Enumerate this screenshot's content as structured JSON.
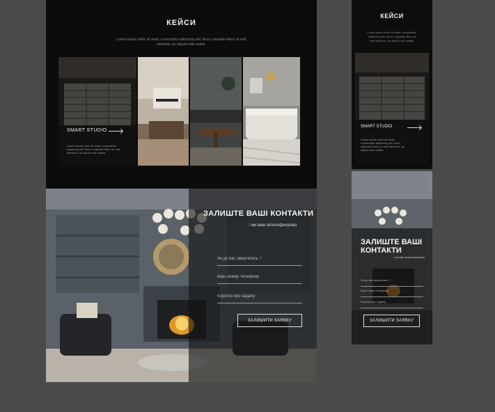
{
  "desktop": {
    "cases": {
      "title": "КЕЙСИ",
      "subtitle": "Lorem ipsum dolor sit amet, consectetur adipiscing elit. Nunc vulputate libero et velit interdum, ac aliquet odio mattis.",
      "featured_label": "SMART STUDIO",
      "featured_text": "Lorem ipsum dolor sit amet, consectetur adipiscing elit. Nunc vulputate libero et velit interdum, ac aliquet odio mattis.",
      "arrow_icon": "arrow-right-icon"
    },
    "contact": {
      "title": "ЗАЛИШТЕ ВАШІ КОНТАКТИ",
      "subtitle": "і ми вам зателефонуємо",
      "name_placeholder": "Як до вас звертатись ?",
      "phone_placeholder": "Ваш номер телефону",
      "task_placeholder": "Коротко про задачу",
      "submit_label": "ЗАЛИШИТИ ЗАЯВКУ"
    }
  },
  "mobile": {
    "cases": {
      "title": "КЕЙСИ",
      "subtitle": "Lorem ipsum dolor sit amet, consectetur adipiscing elit. Nunc vulputate libero et velit interdum, ac aliquet odio mattis.",
      "featured_label": "SMART STUDIO",
      "featured_text": "Lorem ipsum dolor sit amet, consectetur adipiscing elit. Nunc vulputate libero et velit interdum, ac aliquet odio mattis."
    },
    "contact": {
      "title": "ЗАЛИШТЕ ВАШІ КОНТАКТИ",
      "subtitle": "і ми вам зателефонуємо",
      "name_placeholder": "Як до вас звертатись ?",
      "phone_placeholder": "Ваш номер телефону",
      "task_placeholder": "Коротко про задачу",
      "submit_label": "ЗАЛИШИТИ ЗАЯВКУ"
    }
  },
  "colors": {
    "canvas": "#4a4a4a",
    "section_dark": "#0c0c0c",
    "text_light": "#f2f2f2",
    "text_muted": "#8a8a8a",
    "button_border": "#e0e0e0"
  }
}
